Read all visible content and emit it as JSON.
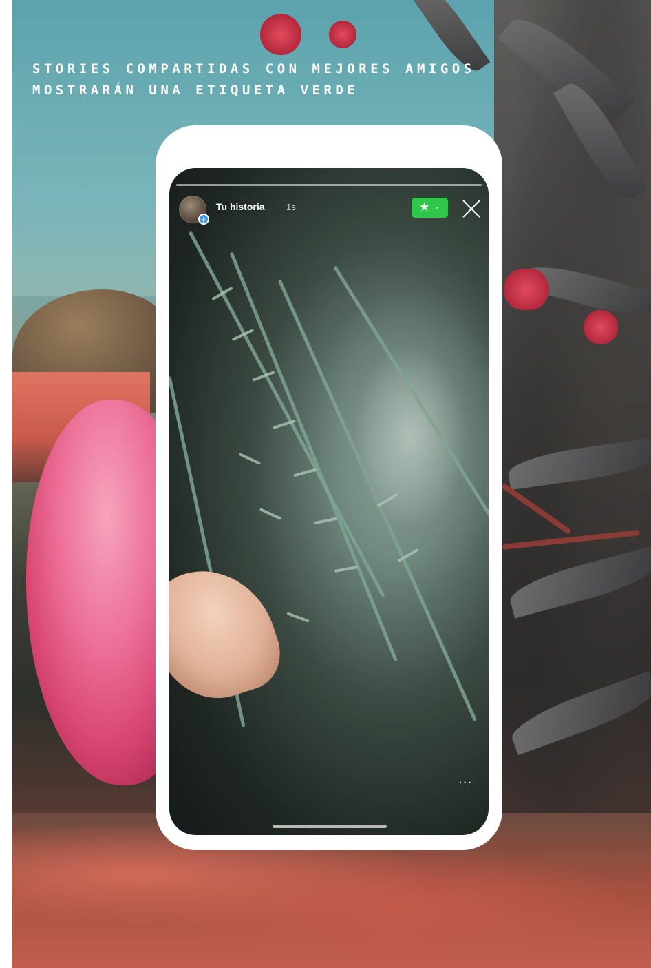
{
  "headline": {
    "line1": "Stories compartidas con mejores amigos",
    "line2": "mostrarán una etiqueta verde"
  },
  "story": {
    "username": "Tu historia",
    "time": "1s",
    "avatar_badge": "+",
    "close_label": "×",
    "more_label": "···",
    "close_friends_badge": {
      "icon": "star-icon",
      "star_glyph": "★",
      "chevron_glyph": "⌄",
      "color": "#2fc64a"
    }
  },
  "colors": {
    "accent_strip": "#a9dfd1",
    "badge_green": "#2fc64a"
  }
}
